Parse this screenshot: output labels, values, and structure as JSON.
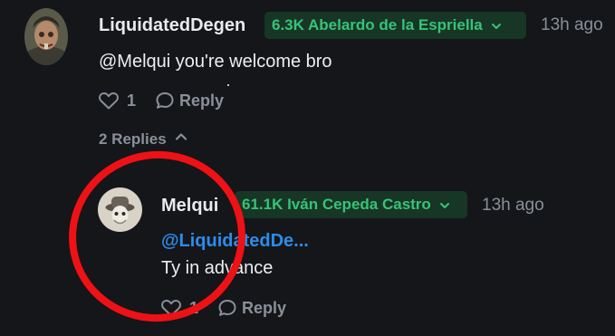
{
  "comment": {
    "username": "LiquidatedDegen",
    "badge_label": "6.3K Abelardo de la Espriella",
    "time": "13h ago",
    "text": "@Melqui you're welcome bro",
    "like_count": "1",
    "reply_label": "Reply",
    "replies_toggle_label": "2 Replies"
  },
  "reply": {
    "username": "Melqui",
    "badge_label": "61.1K Iván Cepeda Castro",
    "time": "13h ago",
    "mention": "@LiquidatedDe...",
    "text": "Ty in advance",
    "like_count": "1",
    "reply_label": "Reply"
  },
  "colors": {
    "background": "#14161a",
    "badge_bg": "#173626",
    "badge_text": "#36c378",
    "mention": "#2d8ceb",
    "muted": "#8a9099",
    "annotation_circle": "#ee1116"
  },
  "icons": {
    "like": "heart-icon",
    "reply": "speech-bubble-icon",
    "badge_dropdown": "chevron-down-icon",
    "replies_toggle": "chevron-up-icon"
  }
}
